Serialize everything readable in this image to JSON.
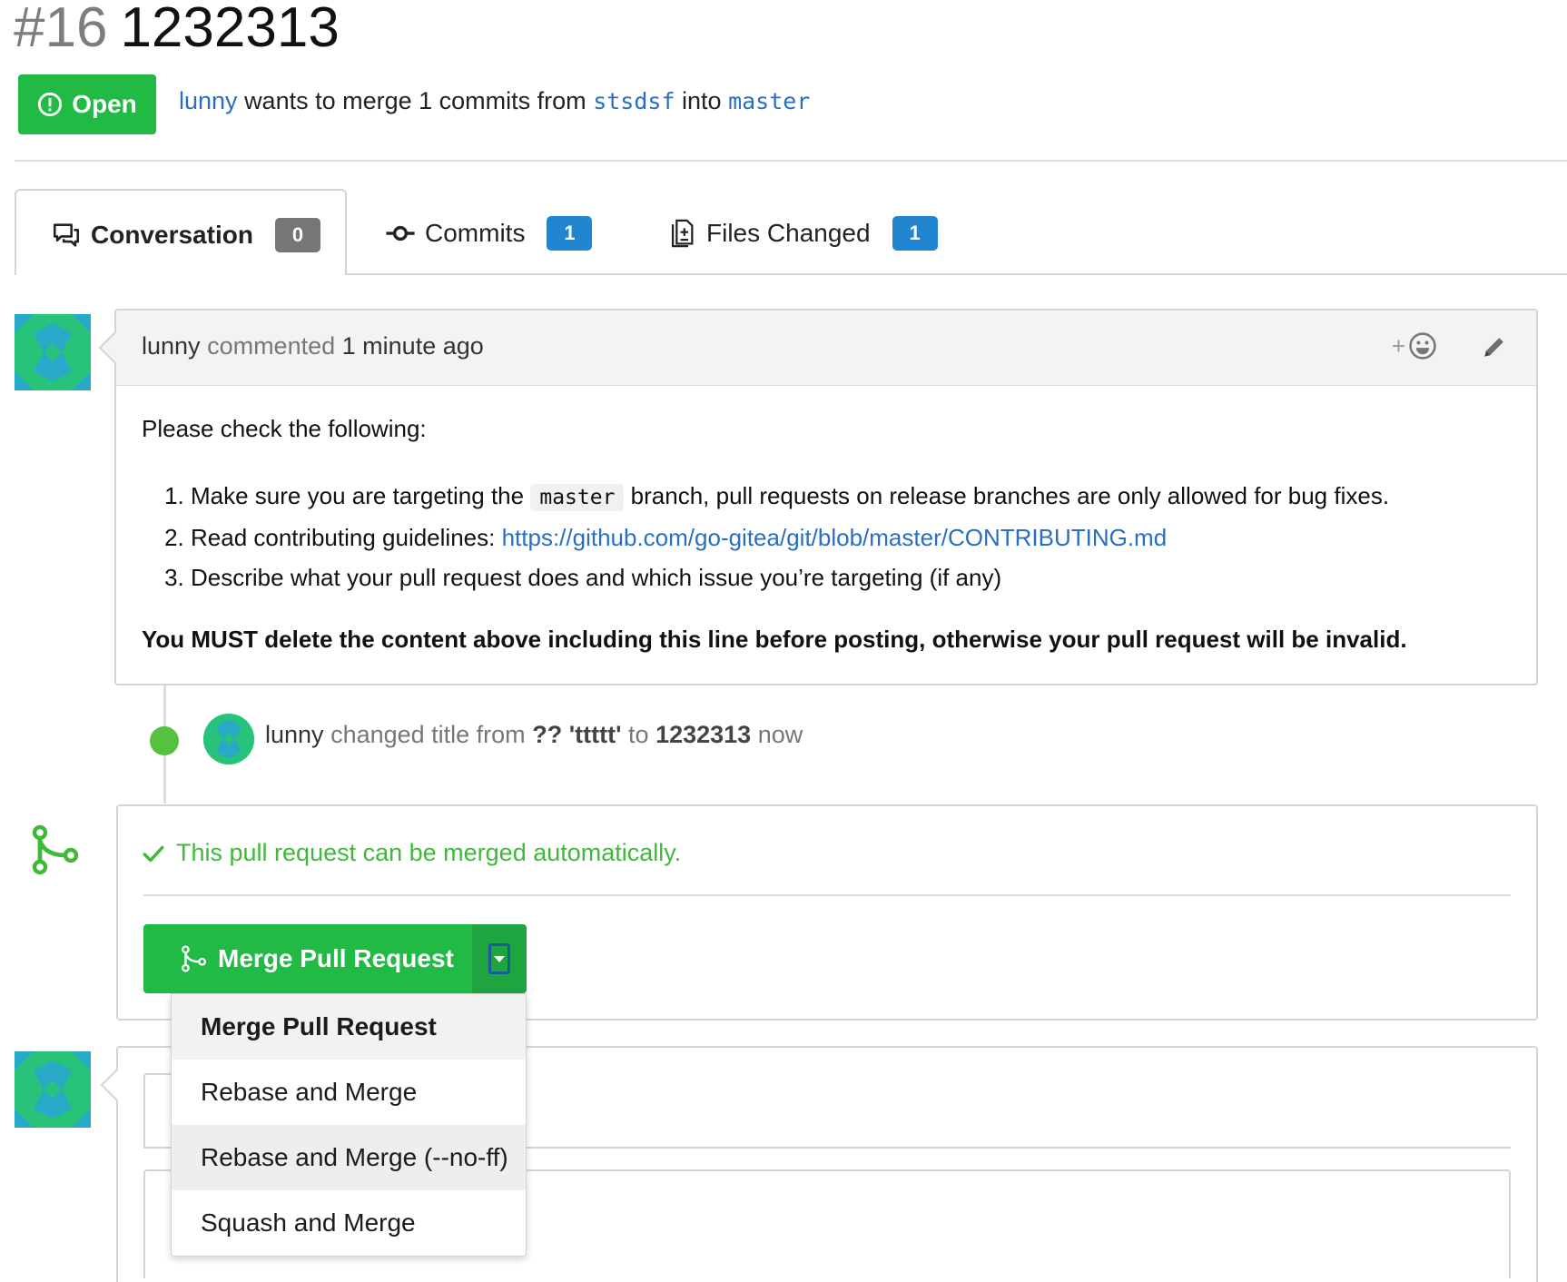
{
  "title": {
    "number": "#16",
    "text": "1232313"
  },
  "status": {
    "badge_label": "Open",
    "author": "lunny",
    "wants_to_merge": "wants to merge 1 commits from",
    "head_branch": "stsdsf",
    "into": "into",
    "base_branch": "master"
  },
  "tabs": [
    {
      "label": "Conversation",
      "count": "0",
      "icon": "comment-discussion-icon"
    },
    {
      "label": "Commits",
      "count": "1",
      "icon": "git-commit-icon"
    },
    {
      "label": "Files Changed",
      "count": "1",
      "icon": "diff-icon"
    }
  ],
  "comment": {
    "author": "lunny",
    "action": "commented",
    "time": "1 minute ago",
    "react_label": "+",
    "intro": "Please check the following:",
    "items": [
      {
        "before": "Make sure you are targeting the",
        "code": "master",
        "after": "branch, pull requests on release branches are only allowed for bug fixes."
      },
      {
        "before": "Read contributing guidelines:",
        "link": "https://github.com/go-gitea/git/blob/master/CONTRIBUTING.md"
      },
      {
        "before": "Describe what your pull request does and which issue you’re targeting (if any)"
      }
    ],
    "warning": "You MUST delete the content above including this line before posting, otherwise your pull request will be invalid."
  },
  "event": {
    "author": "lunny",
    "action": "changed title from",
    "old_title": "?? 'ttttt'",
    "to": "to",
    "new_title": "1232313",
    "when": "now"
  },
  "merge": {
    "status_text": "This pull request can be merged automatically.",
    "button_label": "Merge Pull Request",
    "menu": [
      "Merge Pull Request",
      "Rebase and Merge",
      "Rebase and Merge (--no-ff)",
      "Squash and Merge"
    ]
  },
  "colors": {
    "green": "#21ba45",
    "blue_count": "#2185d0",
    "grey_count": "#767676",
    "link": "#2a6ec4",
    "merge_text": "#3fb93a"
  }
}
